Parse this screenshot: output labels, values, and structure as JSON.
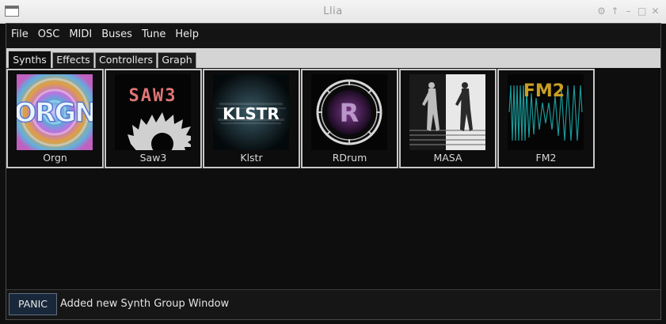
{
  "window": {
    "title": "Llia",
    "controls": [
      "⚙",
      "↑",
      "–",
      "□",
      "✕"
    ]
  },
  "menu": [
    "File",
    "OSC",
    "MIDI",
    "Buses",
    "Tune",
    "Help"
  ],
  "tabs": [
    {
      "label": "Synths",
      "active": true
    },
    {
      "label": "Effects",
      "active": false
    },
    {
      "label": "Controllers",
      "active": false
    },
    {
      "label": "Graph",
      "active": false
    }
  ],
  "synths": [
    {
      "label": "Orgn",
      "logo_text": "ORGN",
      "icon": "orgn-logo"
    },
    {
      "label": "Saw3",
      "logo_text": "SAW3",
      "icon": "saw-blade-logo"
    },
    {
      "label": "Klstr",
      "logo_text": "KLSTR",
      "icon": "klstr-logo"
    },
    {
      "label": "RDrum",
      "logo_text": "R",
      "icon": "drum-logo"
    },
    {
      "label": "MASA",
      "logo_text": "",
      "icon": "masa-figures-logo"
    },
    {
      "label": "FM2",
      "logo_text": "FM2",
      "icon": "fm2-waveform-logo"
    }
  ],
  "status": {
    "panic_label": "PANIC",
    "message": "Added new Synth Group Window"
  },
  "colors": {
    "background": "#0f0f0f",
    "card_border": "#c8c8c8",
    "saw3_text": "#e07575",
    "fm2_text": "#c8a020",
    "fm2_wave": "#1a9a9a",
    "drum_r": "#9a6ab0"
  }
}
